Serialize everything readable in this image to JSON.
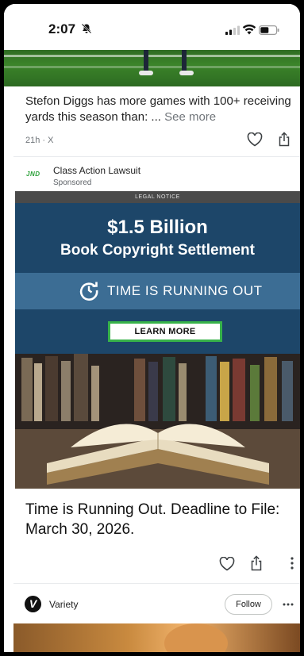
{
  "status_bar": {
    "time": "2:07"
  },
  "story": {
    "text": "Stefon Diggs has more games with 100+ receiving yards this season than: ...",
    "see_more": "See more",
    "meta": "21h · X"
  },
  "ad": {
    "sponsor_logo": "JND",
    "sponsor_name": "Class Action Lawsuit",
    "sponsored_label": "Sponsored",
    "legal_notice": "LEGAL NOTICE",
    "headline_amount": "$1.5 Billion",
    "headline_sub": "Book Copyright Settlement",
    "band_text": "TIME IS RUNNING OUT",
    "cta": "LEARN MORE",
    "title": "Time is Running Out. Deadline to File: March 30, 2026.",
    "accent_color": "#37b24a",
    "band_color": "#3c6d94"
  },
  "next_card": {
    "publisher_logo": "V",
    "publisher": "Variety",
    "follow_label": "Follow"
  },
  "icons": [
    "bell-off-icon",
    "signal-icon",
    "wifi-icon",
    "battery-icon",
    "heart-icon",
    "share-icon",
    "more-vertical-icon",
    "more-horizontal-icon",
    "clock-icon"
  ]
}
